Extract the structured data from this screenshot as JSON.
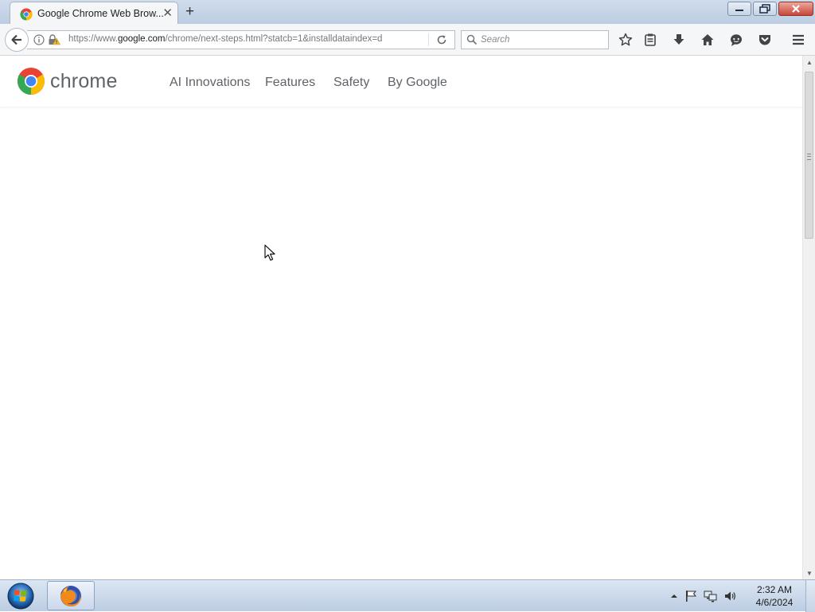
{
  "browser": {
    "tab": {
      "title": "Google Chrome Web Brow...",
      "favicon": "chrome-logo-icon"
    },
    "new_tab_icon": "plus-icon",
    "window_controls": [
      "minimize-icon",
      "restore-icon",
      "close-icon"
    ]
  },
  "toolbar": {
    "url_prefix": "https://www.",
    "url_domain": "google.com",
    "url_path": "/chrome/next-steps.html?statcb=1&installdataindex=d",
    "search_placeholder": "Search",
    "icons": [
      "back-arrow-icon",
      "info-icon",
      "insecure-lock-icon",
      "reload-icon",
      "search-icon",
      "bookmark-star-icon",
      "reading-list-icon",
      "download-icon",
      "home-icon",
      "chat-icon",
      "pocket-icon",
      "menu-icon"
    ]
  },
  "page": {
    "logo_text": "chrome",
    "nav": [
      "AI Innovations",
      "Features",
      "Safety",
      "By Google"
    ]
  },
  "taskbar": {
    "time": "2:32 AM",
    "date": "4/6/2024",
    "tray_icons": [
      "show-hidden-icons-icon",
      "action-center-flag-icon",
      "network-icon",
      "volume-icon"
    ]
  },
  "colors": {
    "chrome_red": "#EA4335",
    "chrome_yellow": "#FBBC05",
    "chrome_green": "#34A853",
    "chrome_blue": "#4285F4",
    "nav_text": "#5f6368"
  }
}
